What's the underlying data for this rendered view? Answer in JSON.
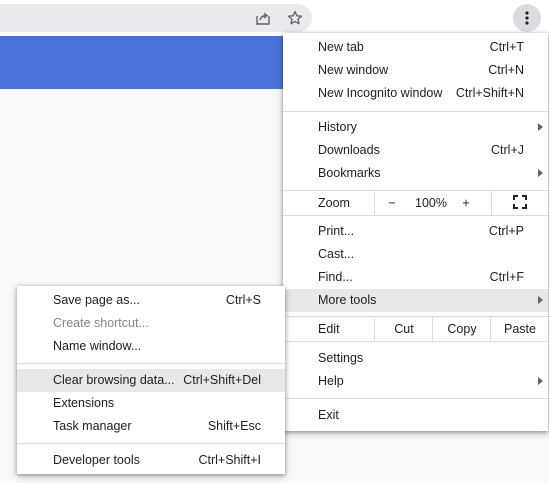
{
  "main_menu": {
    "new_tab": {
      "label": "New tab",
      "shortcut": "Ctrl+T"
    },
    "new_window": {
      "label": "New window",
      "shortcut": "Ctrl+N"
    },
    "new_incognito": {
      "label": "New Incognito window",
      "shortcut": "Ctrl+Shift+N"
    },
    "history": {
      "label": "History"
    },
    "downloads": {
      "label": "Downloads",
      "shortcut": "Ctrl+J"
    },
    "bookmarks": {
      "label": "Bookmarks"
    },
    "zoom": {
      "label": "Zoom",
      "minus": "−",
      "value": "100%",
      "plus": "+"
    },
    "print": {
      "label": "Print...",
      "shortcut": "Ctrl+P"
    },
    "cast": {
      "label": "Cast..."
    },
    "find": {
      "label": "Find...",
      "shortcut": "Ctrl+F"
    },
    "more_tools": {
      "label": "More tools"
    },
    "edit": {
      "label": "Edit",
      "cut": "Cut",
      "copy": "Copy",
      "paste": "Paste"
    },
    "settings": {
      "label": "Settings"
    },
    "help": {
      "label": "Help"
    },
    "exit": {
      "label": "Exit"
    }
  },
  "more_tools_menu": {
    "save_page": {
      "label": "Save page as...",
      "shortcut": "Ctrl+S"
    },
    "create_shortcut": {
      "label": "Create shortcut..."
    },
    "name_window": {
      "label": "Name window..."
    },
    "clear_data": {
      "label": "Clear browsing data...",
      "shortcut": "Ctrl+Shift+Del"
    },
    "extensions": {
      "label": "Extensions"
    },
    "task_manager": {
      "label": "Task manager",
      "shortcut": "Shift+Esc"
    },
    "dev_tools": {
      "label": "Developer tools",
      "shortcut": "Ctrl+Shift+I"
    }
  },
  "icons": {
    "share": "share-icon",
    "bookmark": "star-icon",
    "menu": "kebab-menu-icon",
    "fullscreen": "fullscreen-icon"
  },
  "colors": {
    "banner": "#4a74d9",
    "highlight": "#e8e8e8"
  }
}
